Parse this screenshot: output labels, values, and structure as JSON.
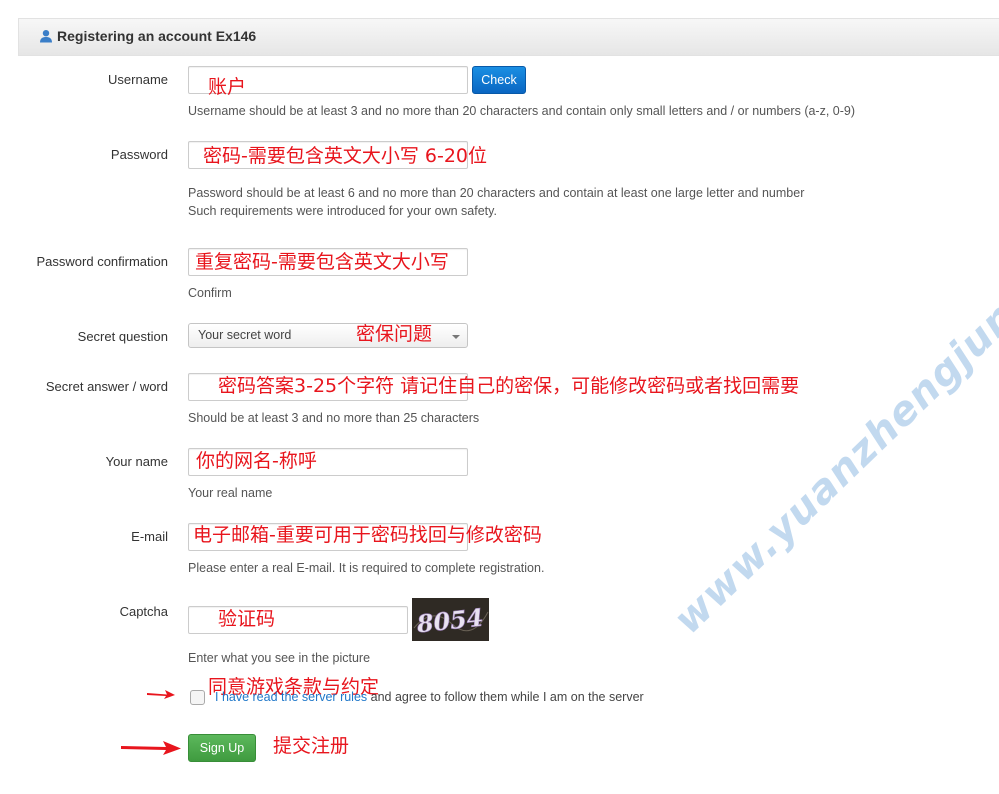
{
  "header": {
    "title": "Registering an account Ex146",
    "icon": "user-icon"
  },
  "form": {
    "username": {
      "label": "Username",
      "note": "账户",
      "check_label": "Check",
      "help": "Username should be at least 3 and no more than 20 characters and contain only small letters and / or numbers (a-z, 0-9)"
    },
    "password": {
      "label": "Password",
      "note": "密码-需要包含英文大小写 6-20位",
      "help1": "Password should be at least 6 and no more than 20 characters and contain at least one large letter and number",
      "help2": "Such requirements were introduced for your own safety."
    },
    "password_confirm": {
      "label": "Password confirmation",
      "note": "重复密码-需要包含英文大小写",
      "help": "Confirm"
    },
    "secret_question": {
      "label": "Secret question",
      "selected": "Your secret word",
      "note": "密保问题"
    },
    "secret_answer": {
      "label": "Secret answer / word",
      "note": "密码答案3-25个字符 请记住自己的密保，可能修改密码或者找回需要",
      "help": "Should be at least 3 and no more than 25 characters"
    },
    "your_name": {
      "label": "Your name",
      "note": "你的网名-称呼",
      "help": "Your real name"
    },
    "email": {
      "label": "E-mail",
      "note": "电子邮箱-重要可用于密码找回与修改密码",
      "help": "Please enter a real E-mail. It is required to complete registration."
    },
    "captcha": {
      "label": "Captcha",
      "note": "验证码",
      "image_text": "8054",
      "help": "Enter what you see in the picture"
    },
    "rules": {
      "link": "I have read the server rules",
      "text": " and agree to follow them while I am on the server",
      "note": "同意游戏条款与约定"
    },
    "submit": {
      "label": "Sign Up",
      "note": "提交注册"
    }
  },
  "watermark": "www.yuanzhengjun.xyz",
  "colors": {
    "annotation": "#e8151d",
    "check_button": "#0a66c2",
    "signup_button": "#4cae4c",
    "link": "#1f77c9"
  }
}
